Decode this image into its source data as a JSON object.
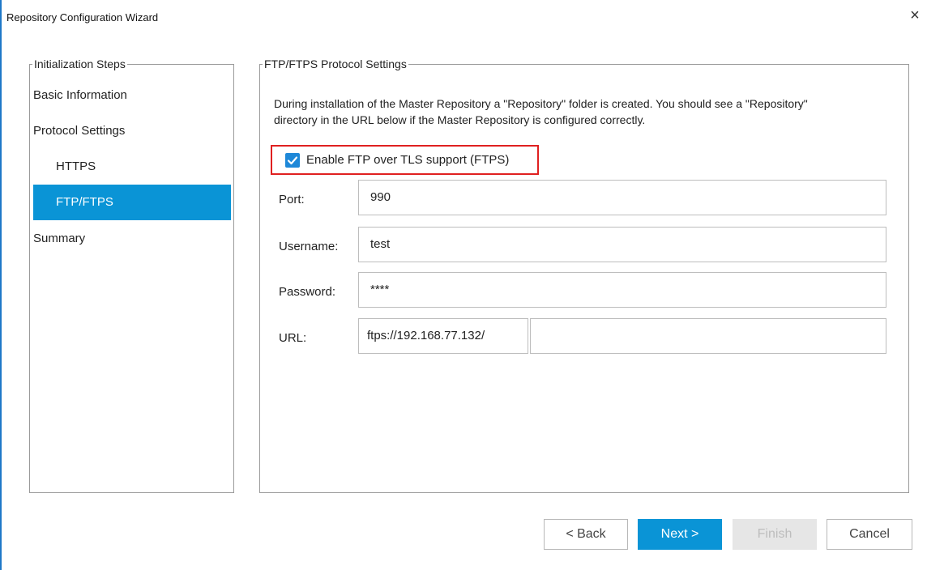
{
  "window": {
    "title": "Repository Configuration Wizard",
    "close_symbol": "×"
  },
  "steps": {
    "legend": "Initialization Steps",
    "items": [
      {
        "label": "Basic Information",
        "active": false
      },
      {
        "label": "Protocol Settings",
        "active": false
      },
      {
        "label": "HTTPS",
        "active": false
      },
      {
        "label": "FTP/FTPS",
        "active": true
      },
      {
        "label": "Summary",
        "active": false
      }
    ]
  },
  "settings": {
    "legend": "FTP/FTPS Protocol Settings",
    "description": "During installation of the Master Repository a \"Repository\" folder is created.  You should see a \"Repository\" directory in the URL below if the Master Repository is configured correctly.",
    "ftps_checkbox": {
      "label": "Enable FTP over TLS support (FTPS)",
      "checked": true,
      "highlight_color": "#e02020"
    },
    "port": {
      "label": "Port:",
      "value": "990"
    },
    "username": {
      "label": "Username:",
      "value": "test"
    },
    "password": {
      "label": "Password:",
      "value": "****"
    },
    "url": {
      "label": "URL:",
      "prefix": "ftps://192.168.77.132/",
      "value": ""
    }
  },
  "buttons": {
    "back": "< Back",
    "next": "Next >",
    "finish": "Finish",
    "cancel": "Cancel"
  },
  "colors": {
    "accent": "#0a94d6",
    "checkbox": "#1e88d8",
    "disabled_bg": "#e6e6e6"
  }
}
